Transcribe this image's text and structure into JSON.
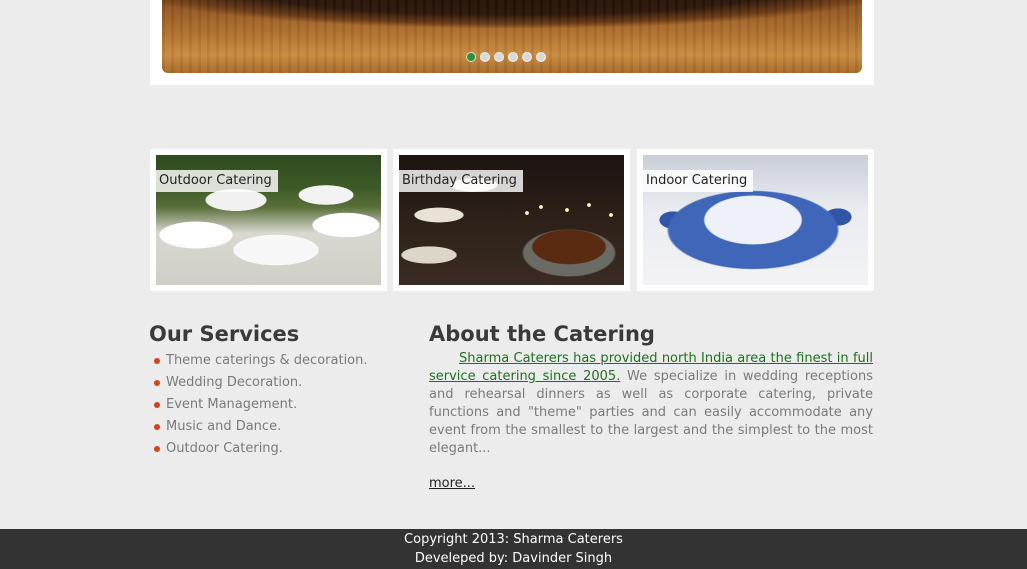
{
  "slider": {
    "dots": [
      {
        "active": true
      },
      {
        "active": false
      },
      {
        "active": false
      },
      {
        "active": false
      },
      {
        "active": false
      },
      {
        "active": false
      }
    ],
    "colors": {
      "active_dot": "#2f8f3a",
      "inactive_dot": "#d9d9d9"
    }
  },
  "cards": [
    {
      "label": "Outdoor Catering",
      "image": "outdoor-catering-photo"
    },
    {
      "label": "Birthday Catering",
      "image": "birthday-cake-photo"
    },
    {
      "label": "Indoor Catering",
      "image": "indoor-table-setting-photo"
    }
  ],
  "services": {
    "title": "Our Services",
    "items": [
      "Theme caterings & decoration.",
      "Wedding Decoration.",
      "Event Management.",
      "Music and Dance.",
      "Outdoor Catering."
    ],
    "bullet_color": "#d4441c"
  },
  "about": {
    "title": "About the Catering",
    "lead_link": "Sharma Caterers has provided north India area the finest in full service catering since 2005.",
    "body": " We specialize in wedding receptions and rehearsal dinners as well as corporate catering, private functions and \"theme\" parties and can easily accommodate any event from the smallest to the largest and the simplest to the most elegant...",
    "more_link": "more...",
    "link_color": "#1f6e22"
  },
  "footer": {
    "copyright": "Copyright 2013: Sharma Caterers",
    "developer": "Develeped by: Davinder Singh",
    "background": "#333333"
  }
}
